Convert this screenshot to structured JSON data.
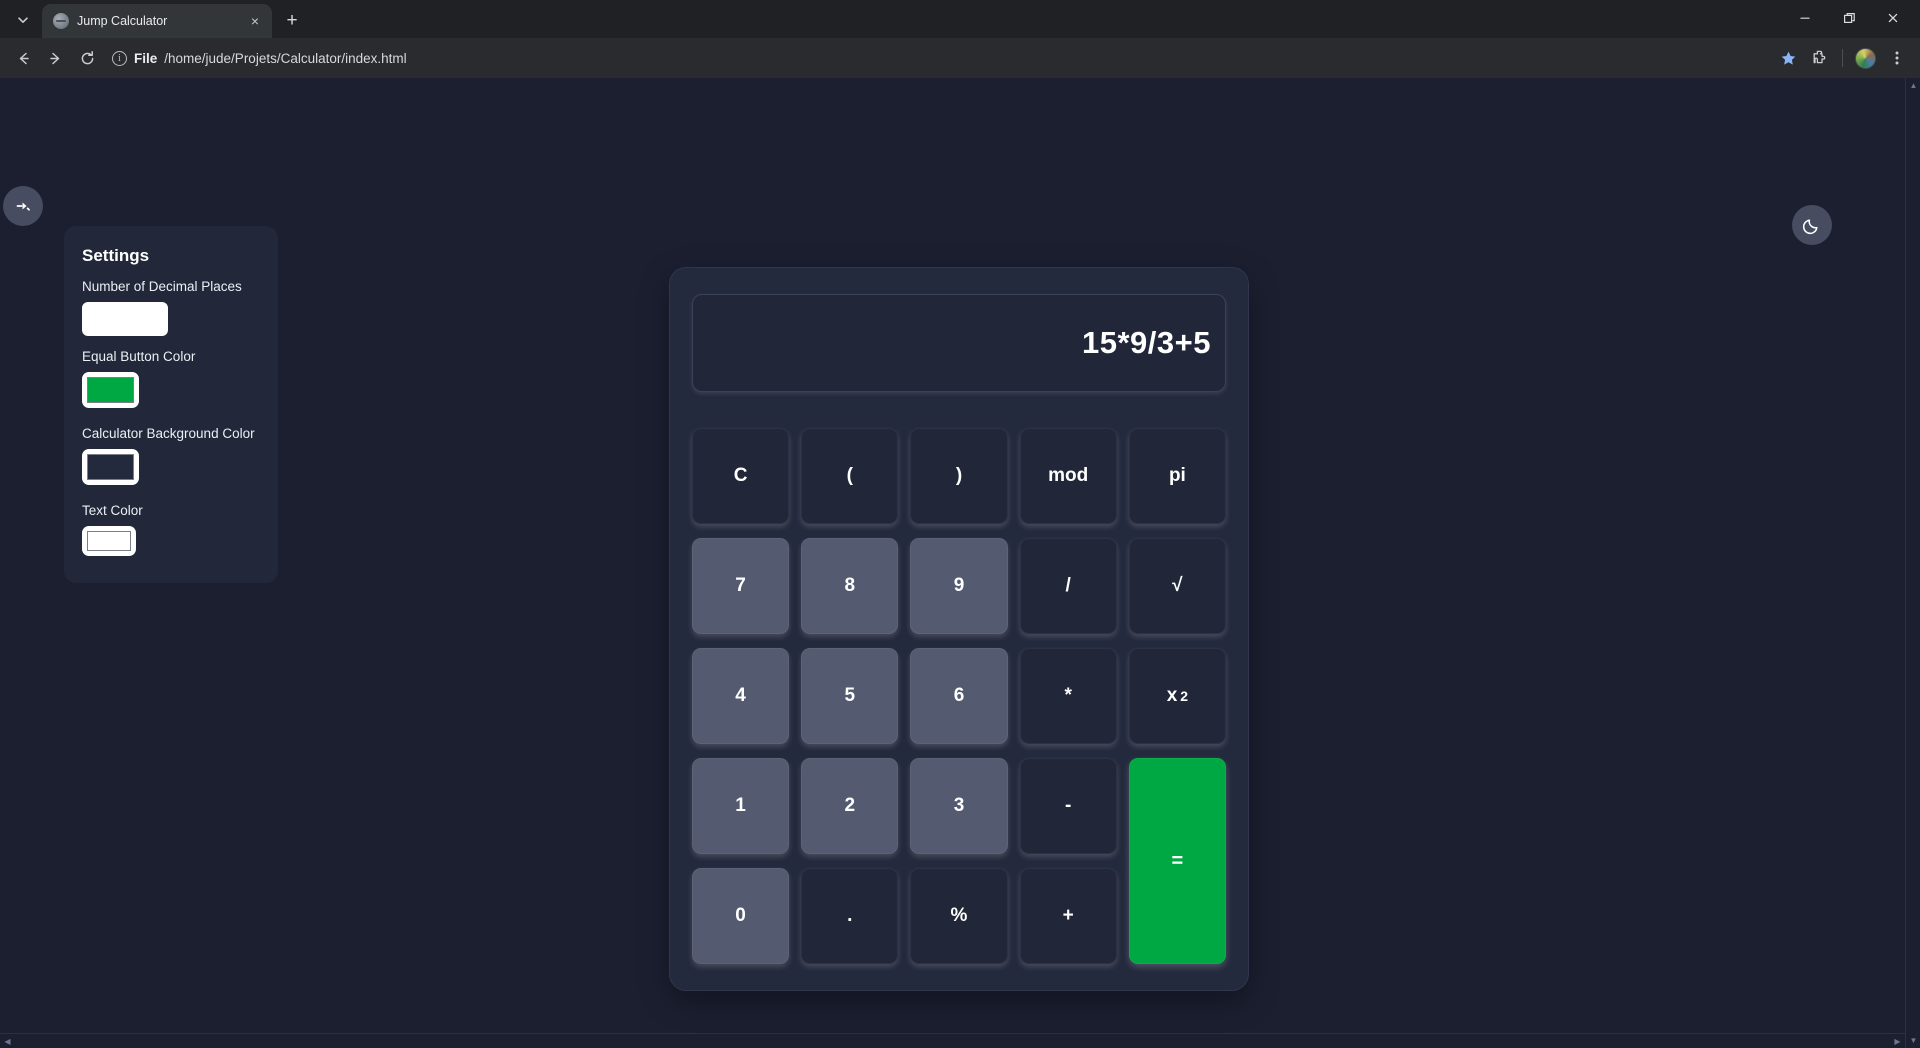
{
  "browser": {
    "tab": {
      "title": "Jump Calculator",
      "close_label": "×",
      "favicon": "globe-icon"
    },
    "new_tab_label": "+",
    "window_controls": {
      "minimize": "minimize-icon",
      "maximize": "maximize-icon",
      "close": "close-icon"
    },
    "toolbar": {
      "back": "back-arrow-icon",
      "forward": "forward-arrow-icon",
      "reload": "reload-icon",
      "scheme_label": "File",
      "url": "/home/jude/Projets/Calculator/index.html",
      "bookmark": "star-icon",
      "extensions": "puzzle-icon",
      "profile": "avatar-icon",
      "menu": "three-dot-menu-icon"
    }
  },
  "page": {
    "collapse_toggle": "collapse-panel-icon",
    "theme_toggle": "moon-icon",
    "settings": {
      "title": "Settings",
      "fields": [
        {
          "label": "Number of Decimal Places",
          "type": "number",
          "value": "",
          "swatch_color": "#ffffff"
        },
        {
          "label": "Equal Button Color",
          "type": "color",
          "value": "#00a844"
        },
        {
          "label": "Calculator Background Color",
          "type": "color",
          "value": "#242a3d"
        },
        {
          "label": "Text Color",
          "type": "color",
          "value": "#ffffff"
        }
      ]
    },
    "calculator": {
      "display_value": "15*9/3+5",
      "keys": [
        {
          "label": "C",
          "kind": "op"
        },
        {
          "label": "(",
          "kind": "op"
        },
        {
          "label": ")",
          "kind": "op"
        },
        {
          "label": "mod",
          "kind": "op"
        },
        {
          "label": "pi",
          "kind": "op"
        },
        {
          "label": "7",
          "kind": "num"
        },
        {
          "label": "8",
          "kind": "num"
        },
        {
          "label": "9",
          "kind": "num"
        },
        {
          "label": "/",
          "kind": "op"
        },
        {
          "label": "√",
          "kind": "op"
        },
        {
          "label": "4",
          "kind": "num"
        },
        {
          "label": "5",
          "kind": "num"
        },
        {
          "label": "6",
          "kind": "num"
        },
        {
          "label": "*",
          "kind": "op"
        },
        {
          "label": "x",
          "kind": "op",
          "sup": "2"
        },
        {
          "label": "1",
          "kind": "num"
        },
        {
          "label": "2",
          "kind": "num"
        },
        {
          "label": "3",
          "kind": "num"
        },
        {
          "label": "-",
          "kind": "op"
        },
        {
          "label": "=",
          "kind": "equal"
        },
        {
          "label": "0",
          "kind": "num"
        },
        {
          "label": ".",
          "kind": "op"
        },
        {
          "label": "%",
          "kind": "op"
        },
        {
          "label": "+",
          "kind": "op"
        }
      ]
    }
  },
  "colors": {
    "page_background": "#1b1f30",
    "panel_background": "#222739",
    "calculator_background": "#242a3d",
    "number_key": "#545a70",
    "operator_key": "#212739",
    "equal_key": "#00a844",
    "text": "#ffffff"
  }
}
